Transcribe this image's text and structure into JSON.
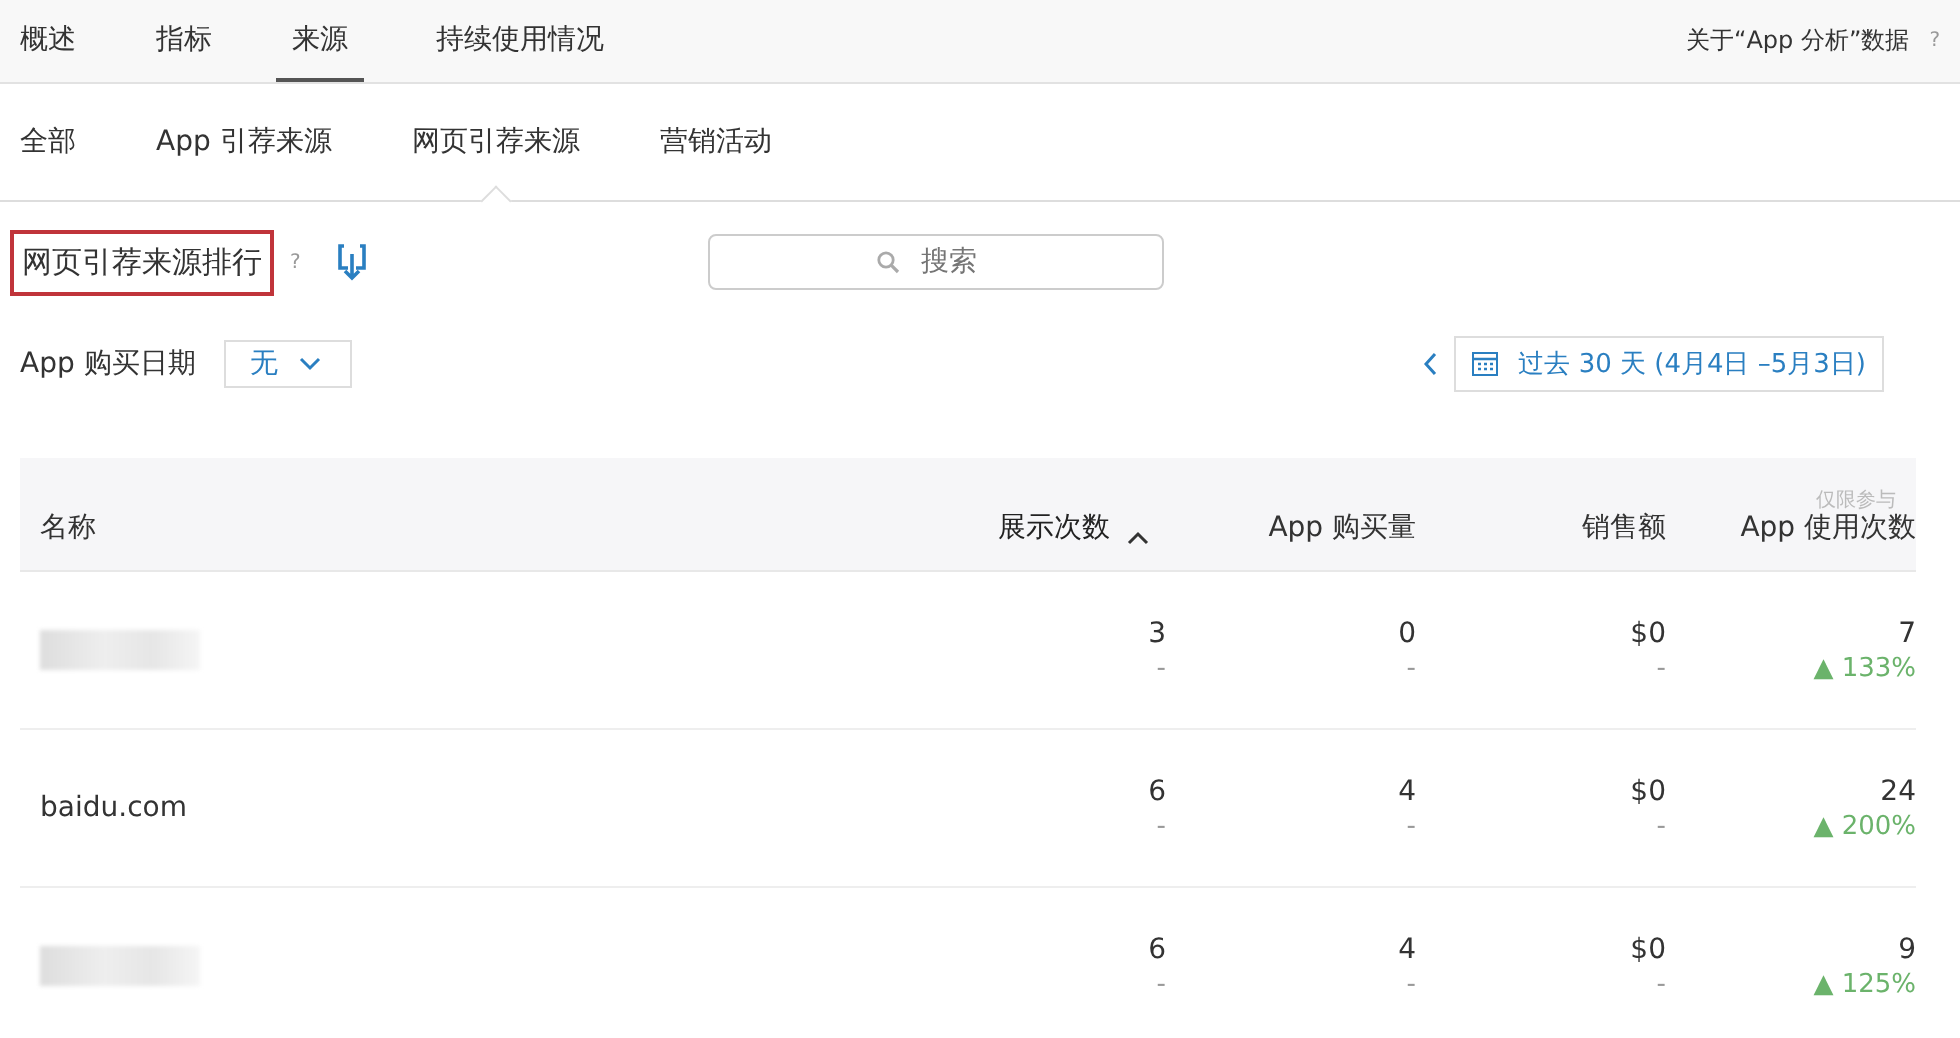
{
  "top_tabs": [
    {
      "label": "概述",
      "selected": false
    },
    {
      "label": "指标",
      "selected": false
    },
    {
      "label": "来源",
      "selected": true
    },
    {
      "label": "持续使用情况",
      "selected": false
    }
  ],
  "about_link": "关于“App 分析”数据",
  "about_help": "?",
  "sub_tabs": [
    {
      "label": "全部",
      "selected": false
    },
    {
      "label": "App 引荐来源",
      "selected": false
    },
    {
      "label": "网页引荐来源",
      "selected": true
    },
    {
      "label": "营销活动",
      "selected": false
    }
  ],
  "section_title": {
    "text": "网页引荐来源排行",
    "highlighted": true,
    "help": "?"
  },
  "search": {
    "placeholder": "搜索"
  },
  "purchase_date": {
    "label": "App 购买日期",
    "value": "无"
  },
  "date_range": "过去 30 天 (4月4日 –5月3日)",
  "table": {
    "note": "仅限参与",
    "columns": [
      {
        "label": "名称",
        "sorted": false
      },
      {
        "label": "展示次数",
        "sorted": true
      },
      {
        "label": "App 购买量",
        "sorted": false
      },
      {
        "label": "销售额",
        "sorted": false
      },
      {
        "label": "App 使用次数",
        "sorted": false
      }
    ],
    "rows": [
      {
        "cells": [
          {
            "redacted": true
          },
          {
            "value": "3",
            "change": "-"
          },
          {
            "value": "0",
            "change": "-"
          },
          {
            "value": "$0",
            "change": "-"
          },
          {
            "value": "7",
            "change": "▲ 133%",
            "positive": true
          }
        ]
      },
      {
        "cells": [
          {
            "redacted": false,
            "value": "baidu.com"
          },
          {
            "value": "6",
            "change": "-"
          },
          {
            "value": "4",
            "change": "-"
          },
          {
            "value": "$0",
            "change": "-"
          },
          {
            "value": "24",
            "change": "▲ 200%",
            "positive": true
          }
        ]
      },
      {
        "cells": [
          {
            "redacted": true
          },
          {
            "value": "6",
            "change": "-"
          },
          {
            "value": "4",
            "change": "-"
          },
          {
            "value": "$0",
            "change": "-"
          },
          {
            "value": "9",
            "change": "▲ 125%",
            "positive": true
          }
        ]
      }
    ]
  }
}
